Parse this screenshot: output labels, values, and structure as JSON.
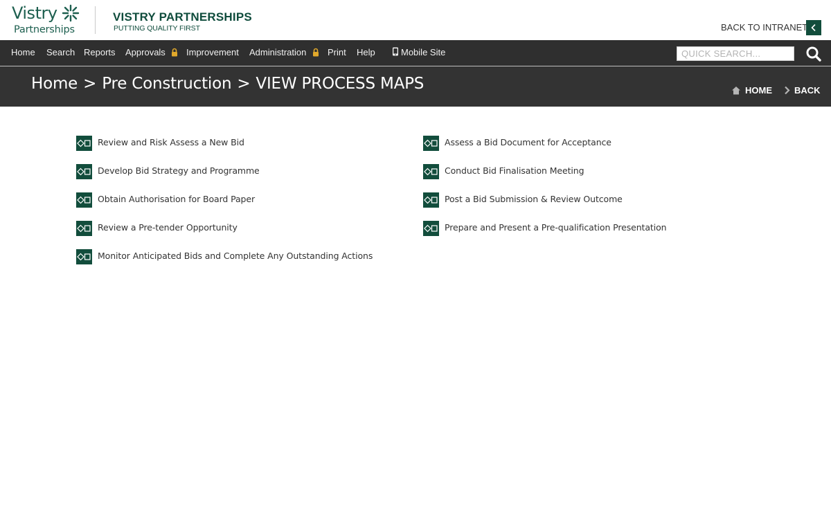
{
  "header": {
    "logo_word": "Vistry",
    "logo_sub": "Partnerships",
    "brand_title": "VISTRY PARTNERSHIPS",
    "brand_tagline": "PUTTING QUALITY FIRST",
    "back_to_intranet": "BACK TO INTRANET"
  },
  "nav": {
    "items": [
      {
        "label": "Home"
      },
      {
        "label": "Search"
      },
      {
        "label": "Reports"
      },
      {
        "label": "Approvals",
        "locked": true
      },
      {
        "label": "Improvement"
      },
      {
        "label": "Administration",
        "locked": true
      },
      {
        "label": "Print"
      },
      {
        "label": "Help"
      },
      {
        "label": "Mobile Site",
        "icon": "mobile-phone-icon"
      }
    ],
    "search_placeholder": "QUICK SEARCH..."
  },
  "title_band": {
    "breadcrumb": [
      "Home",
      "Pre Construction",
      "VIEW PROCESS MAPS"
    ],
    "separator": ">",
    "home_label": "HOME",
    "back_label": "BACK"
  },
  "process_maps": {
    "left_column": [
      "Review and Risk Assess a New Bid",
      "Develop Bid Strategy and Programme",
      "Obtain Authorisation for Board Paper",
      "Review a Pre-tender Opportunity",
      "Monitor Anticipated Bids and Complete Any Outstanding Actions"
    ],
    "right_column": [
      "Assess a Bid Document for Acceptance",
      "Conduct Bid Finalisation Meeting",
      "Post a Bid Submission & Review Outcome",
      "Prepare and Present a Pre-qualification Presentation"
    ]
  },
  "colors": {
    "brand_green": "#124d3c",
    "nav_bg": "#2f2f2f",
    "title_band_bg": "#333333",
    "lock_gold": "#e2a92b"
  }
}
